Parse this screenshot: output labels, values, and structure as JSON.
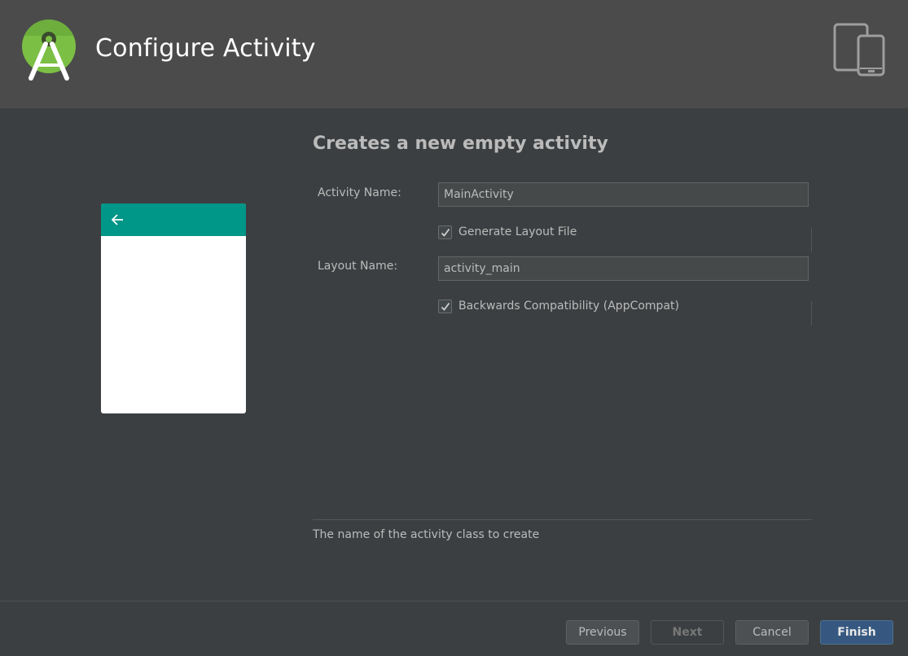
{
  "header": {
    "title": "Configure Activity",
    "logo_icon": "android-studio-logo-icon",
    "device_icon": "tablet-phone-icon"
  },
  "preview": {
    "toolbar_color": "#009688",
    "back_icon": "arrow-left-icon"
  },
  "form": {
    "section_title": "Creates a new empty activity",
    "activity_name_label": "Activity Name:",
    "activity_name_value": "MainActivity",
    "generate_layout_label": "Generate Layout File",
    "generate_layout_checked": true,
    "layout_name_label": "Layout Name:",
    "layout_name_value": "activity_main",
    "backwards_compat_label": "Backwards Compatibility (AppCompat)",
    "backwards_compat_checked": true
  },
  "description": "The name of the activity class to create",
  "buttons": {
    "previous": "Previous",
    "next": "Next",
    "cancel": "Cancel",
    "finish": "Finish"
  },
  "colors": {
    "background": "#3c3f41",
    "header": "#4b4b4b",
    "primary_button": "#365880"
  }
}
